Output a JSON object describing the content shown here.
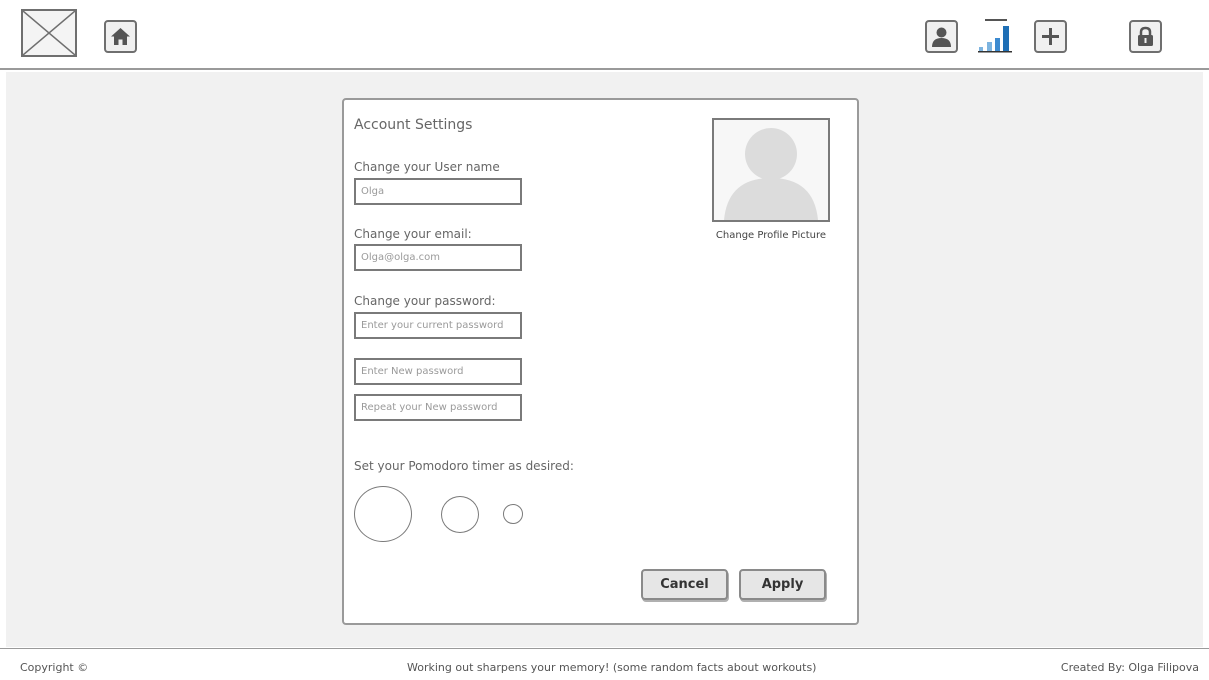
{
  "header": {
    "logo_icon": "image-placeholder-icon",
    "home_icon": "home-icon",
    "profile_icon": "user-icon",
    "stats_icon": "bar-chart-icon",
    "add_icon": "plus-icon",
    "lock_icon": "lock-icon"
  },
  "form": {
    "title": "Account Settings",
    "username_label": "Change your User name",
    "username_value": "Olga",
    "email_label": "Change your email:",
    "email_value": "Olga@olga.com",
    "password_label": "Change your password:",
    "current_password_placeholder": "Enter your current password",
    "new_password_placeholder": "Enter New password",
    "repeat_password_placeholder": "Repeat your New password",
    "pomodoro_label": "Set your Pomodoro timer as desired:",
    "profile_picture_caption": "Change Profile Picture",
    "cancel_label": "Cancel",
    "apply_label": "Apply"
  },
  "footer": {
    "copyright": "Copyright ©",
    "fact": "Working out sharpens your memory! (some random facts about workouts)",
    "credit": "Created By: Olga Filipova"
  },
  "colors": {
    "page_background": "#f1f1f1",
    "border": "#7a7a7a",
    "chart_bars": "#1f6fb5"
  }
}
